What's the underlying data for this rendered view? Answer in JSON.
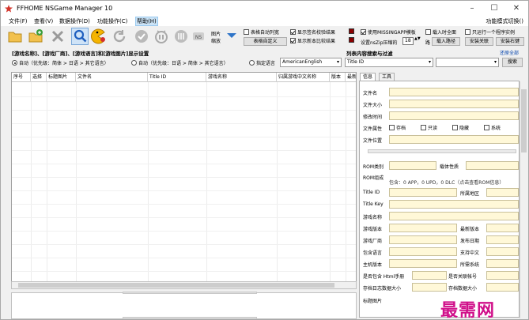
{
  "window": {
    "title": "FFHOME NSGame Manager 10",
    "minimize": "–",
    "maximize": "☐",
    "close": "✕"
  },
  "menu": {
    "items": [
      "文件(F)",
      "查看(V)",
      "数据操作(D)",
      "功能操作(C)",
      "帮助(H)"
    ],
    "right": "功能模式切换()"
  },
  "toolbar": {
    "icons": [
      "open-folder-icon",
      "add-folder-icon",
      "delete-icon",
      "search-person-icon",
      "pacman-icon",
      "refresh-icon",
      "check-icon",
      "pause-icon",
      "coin-icon",
      "ns-icon"
    ],
    "ns_label": "NS",
    "image_zoom_label_1": "图片",
    "image_zoom_label_2": "缩放",
    "checks": {
      "auto_width": "表格自动列宽",
      "show_sig": "显示签名校验结果",
      "show_version": "显示新本比较结果",
      "use_missing": "使用MISSINGAPP模板",
      "load_all": "载入时全面",
      "single_instance": "只运行一个程序实例"
    },
    "table_custom": "表格自定义",
    "nsz_label": "设置nsZip压缩的",
    "nsz_value": "18",
    "path_label": "路",
    "load_path": "载入路径",
    "install_assoc": "安装关联",
    "install_right": "安装右键"
  },
  "settings": {
    "heading": "[游戏名称]、[游戏厂商]、[游戏语言]和[游戏图片]显示设置",
    "radio_auto1": "自动（优先级：简体 > 日语 > 其它语言）",
    "radio_auto2": "自动（优先级：日语 > 简体 > 其它语言）",
    "radio_specify": "指定语言",
    "lang_value": "AmericanEnglish",
    "filter_heading": "列表内容搜索与过滤",
    "reset_all": "还原全部",
    "filter_field": "Title ID",
    "filter_value": "",
    "search_button": "搜索"
  },
  "grid": {
    "columns": [
      "序号",
      "选择",
      "标题图片",
      "文件名",
      "Title ID",
      "游戏名称",
      "归属游戏中文名称",
      "版本",
      "最新版本"
    ]
  },
  "right_panel": {
    "tabs": [
      "信息",
      "工具"
    ],
    "labels": {
      "file_name": "文件名",
      "file_size": "文件大小",
      "modified": "修改时间",
      "file_attr": "文件属性",
      "attr_archive": "存档",
      "attr_readonly": "只读",
      "attr_hidden": "隐藏",
      "attr_system": "系统",
      "file_location": "文件位置",
      "rom_type": "ROM类别",
      "rom_carrier": "载体性质",
      "rom_group": "ROM组成",
      "rom_contents": "包含：0 APP，0 UPD，0 DLC（点击查看ROM信息）",
      "title_id": "Title ID",
      "region": "所属地区",
      "title_key": "Title Key",
      "game_name": "游戏名称",
      "game_version": "游戏版本",
      "latest_version": "最新版本",
      "publisher": "游戏厂商",
      "release_date": "发布日期",
      "languages": "包含语言",
      "chinese": "支持中文",
      "main_version": "主机版本",
      "required_system": "所需系统",
      "html_manual": "是否包含 Html手册",
      "related_account": "是否关联帐号",
      "save_size": "存档日志数据大小",
      "save_data_size": "存档数据大小",
      "title_image": "标题图片"
    }
  },
  "watermark": "最需网",
  "colors": {
    "field": "#fff8d8",
    "swatch": "#8b0000",
    "watermark": "#d0108a",
    "accent": "#cfe3f7"
  }
}
